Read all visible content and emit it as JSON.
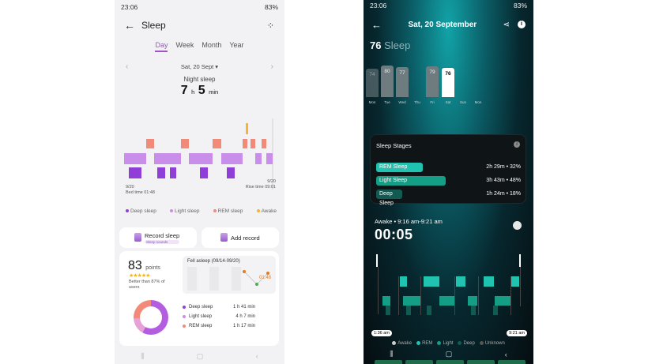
{
  "left": {
    "status": {
      "time": "23:06",
      "battery": "83%"
    },
    "header": {
      "title": "Sleep"
    },
    "tabs": [
      {
        "label": "Day",
        "active": true
      },
      {
        "label": "Week",
        "active": false
      },
      {
        "label": "Month",
        "active": false
      },
      {
        "label": "Year",
        "active": false
      }
    ],
    "date": "Sat, 20 Sept",
    "night_sleep": {
      "label": "Night sleep",
      "hours": "7",
      "h_unit": "h",
      "minutes": "5",
      "m_unit": "min"
    },
    "chart_labels": {
      "start_date": "9/20",
      "start_text": "Bed time 01:48",
      "end_date": "9/20",
      "end_text": "Rise time 09:01"
    },
    "legend": [
      {
        "label": "Deep sleep",
        "color": "#8f3fd8"
      },
      {
        "label": "Light sleep",
        "color": "#c98ee9"
      },
      {
        "label": "REM sleep",
        "color": "#f28a7a"
      },
      {
        "label": "Awake",
        "color": "#f6b431"
      }
    ],
    "record_sleep": {
      "label": "Record sleep",
      "sub": "Sleep sounds"
    },
    "add_record": {
      "label": "Add record"
    },
    "score": {
      "value": "83",
      "unit": "points",
      "stars": "★★★★★",
      "better": "Better than 87% of users"
    },
    "fell_asleep": {
      "title": "Fell asleep (09/14-09/20)",
      "value": "01:48"
    },
    "stages": [
      {
        "label": "Deep sleep",
        "value": "1 h 41 min",
        "color": "#8f3fd8"
      },
      {
        "label": "Light sleep",
        "value": "4 h 7 min",
        "color": "#c98ee9"
      },
      {
        "label": "REM sleep",
        "value": "1 h 17 min",
        "color": "#f28a7a"
      }
    ]
  },
  "right": {
    "status": {
      "time": "23:06",
      "battery": "83%"
    },
    "header": {
      "title": "Sat, 20 September"
    },
    "score": {
      "value": "76",
      "label": "Sleep"
    },
    "week": [
      {
        "day": "Mon",
        "score": "74",
        "selected": false
      },
      {
        "day": "Tue",
        "score": "80",
        "selected": false
      },
      {
        "day": "Wed",
        "score": "77",
        "selected": false
      },
      {
        "day": "Thu",
        "score": "",
        "selected": false
      },
      {
        "day": "Fri",
        "score": "79",
        "selected": false
      },
      {
        "day": "Sat",
        "score": "76",
        "selected": true
      },
      {
        "day": "Sun",
        "score": "",
        "selected": false
      },
      {
        "day": "Mon",
        "score": "",
        "selected": false
      }
    ],
    "stages_title": "Sleep Stages",
    "stages": [
      {
        "label": "REM Sleep",
        "value": "2h 29m • 32%",
        "color": "#1fc3b0",
        "share": 0.32
      },
      {
        "label": "Light Sleep",
        "value": "3h 43m • 48%",
        "color": "#159e86",
        "share": 0.48
      },
      {
        "label": "Deep Sleep",
        "value": "1h 24m • 18%",
        "color": "#125a52",
        "share": 0.18
      }
    ],
    "awake": {
      "label": "Awake • 9:16 am-9:21 am",
      "duration": "00:05"
    },
    "time_start": "1:36 am",
    "time_end": "9:21 am",
    "legend": [
      {
        "label": "Awake",
        "color": "#cccccc"
      },
      {
        "label": "REM",
        "color": "#1fc3b0"
      },
      {
        "label": "Light",
        "color": "#159e86"
      },
      {
        "label": "Deep",
        "color": "#125a52"
      },
      {
        "label": "Unknown",
        "color": "#555555"
      }
    ]
  }
}
